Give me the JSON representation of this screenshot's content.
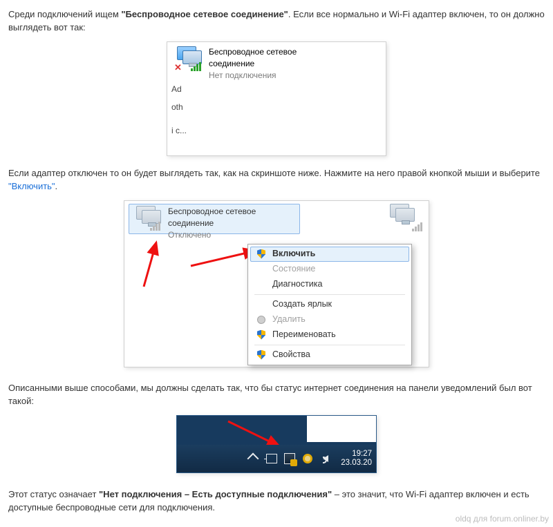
{
  "para1": {
    "pre": "Среди подключений ищем ",
    "bold": "\"Беспроводное сетевое соединение\"",
    "post": ". Если все нормально и Wi-Fi адаптер включен, то он должно выглядеть вот так:"
  },
  "ss1": {
    "title_l1": "Беспроводное сетевое",
    "title_l2": "соединение",
    "status": "Нет подключения",
    "frag_a": "Ad",
    "frag_b": "oth",
    "frag_c": "і с..."
  },
  "para2": {
    "pre": "Если адаптер отключен то он будет выглядеть так, как на скриншоте ниже. Нажмите на него правой кнопкой мыши и выберите ",
    "link": "\"Включить\"",
    "post": "."
  },
  "ss2": {
    "title_l1": "Беспроводное сетевое",
    "title_l2": "соединение",
    "status": "Отключено",
    "menu": {
      "enable": "Включить",
      "state": "Состояние",
      "diag": "Диагностика",
      "shortcut": "Создать ярлык",
      "delete": "Удалить",
      "rename": "Переименовать",
      "props": "Свойства"
    }
  },
  "para3": "Описанными выше способами,  мы должны сделать так, что бы статус интернет соединения на панели уведомлений был вот такой:",
  "ss3": {
    "time": "19:27",
    "date": "23.03.20"
  },
  "para4": {
    "pre": "Этот статус означает ",
    "bold": "\"Нет подключения – Есть доступные подключения\"",
    "post": " – это значит, что Wi-Fi адаптер включен и есть доступные беспроводные сети для подключения."
  },
  "watermark": "oldq для forum.onliner.by"
}
